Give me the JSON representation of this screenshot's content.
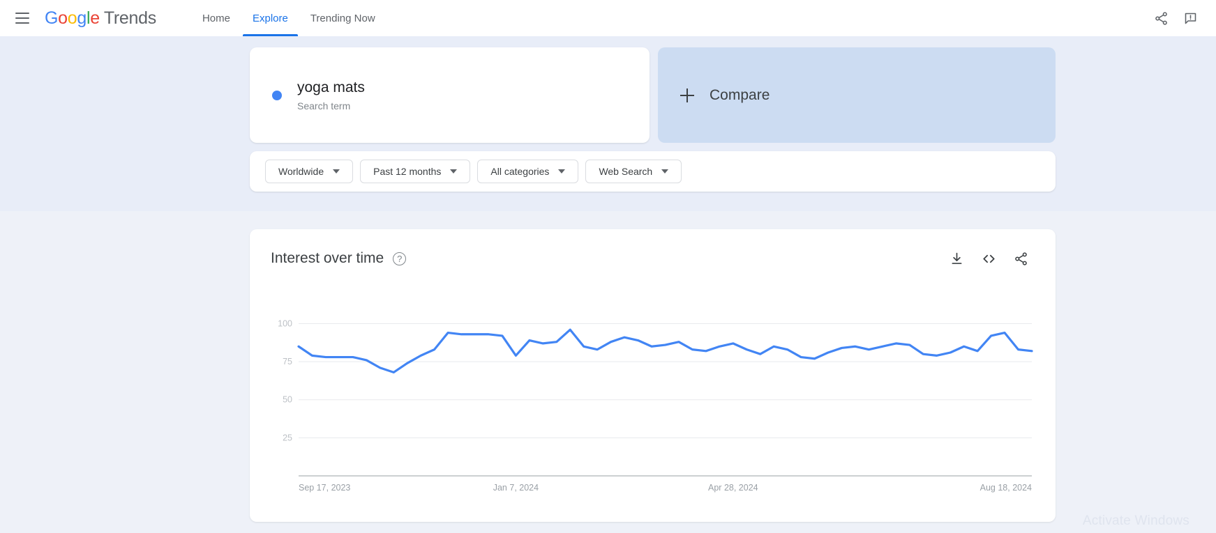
{
  "header": {
    "menu_icon": "hamburger-icon",
    "brand": {
      "google": "Google",
      "product": "Trends"
    },
    "nav": [
      {
        "label": "Home",
        "active": false
      },
      {
        "label": "Explore",
        "active": true
      },
      {
        "label": "Trending Now",
        "active": false
      }
    ],
    "actions": [
      {
        "name": "share-icon",
        "label": "Share"
      },
      {
        "name": "feedback-icon",
        "label": "Send feedback"
      }
    ]
  },
  "query": {
    "term": {
      "name": "yoga mats",
      "type": "Search term",
      "dot_color": "#4285f4"
    },
    "compare": {
      "label": "Compare",
      "icon": "plus-icon"
    },
    "filters": [
      {
        "name": "location-filter",
        "value": "Worldwide"
      },
      {
        "name": "time-range-filter",
        "value": "Past 12 months"
      },
      {
        "name": "category-filter",
        "value": "All categories"
      },
      {
        "name": "search-type-filter",
        "value": "Web Search"
      }
    ]
  },
  "chart_card": {
    "title": "Interest over time",
    "help_glyph": "?",
    "actions": [
      {
        "name": "download-csv-icon",
        "label": "Download CSV"
      },
      {
        "name": "embed-code-icon",
        "label": "Embed"
      },
      {
        "name": "share-chart-icon",
        "label": "Share"
      }
    ]
  },
  "chart_data": {
    "type": "line",
    "title": "Interest over time",
    "xlabel": "",
    "ylabel": "",
    "ylim": [
      0,
      108
    ],
    "yticks": [
      25,
      50,
      75,
      100
    ],
    "grid": true,
    "legend": false,
    "line_color": "#4285f4",
    "xtick_labels": [
      "Sep 17, 2023",
      "Jan 7, 2024",
      "Apr 28, 2024",
      "Aug 18, 2024"
    ],
    "xtick_positions": [
      0,
      16,
      32,
      48
    ],
    "series": [
      {
        "name": "yoga mats",
        "color": "#4285f4",
        "values": [
          85,
          79,
          78,
          78,
          78,
          76,
          71,
          68,
          74,
          79,
          83,
          94,
          93,
          93,
          93,
          92,
          79,
          89,
          87,
          88,
          96,
          85,
          83,
          88,
          91,
          89,
          85,
          86,
          88,
          83,
          82,
          85,
          87,
          83,
          80,
          85,
          83,
          78,
          77,
          81,
          84,
          85,
          83,
          85,
          87,
          86,
          80,
          79,
          81,
          85,
          82,
          92,
          94,
          83,
          82
        ]
      }
    ]
  },
  "watermark": {
    "text": "Activate Windows"
  }
}
